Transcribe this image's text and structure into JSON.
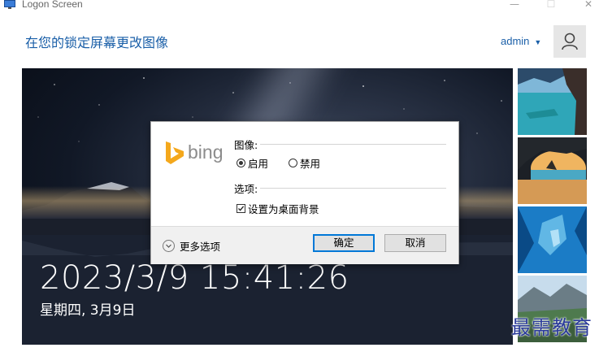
{
  "window": {
    "title": "Logon Screen",
    "min_icon": "minimize-icon",
    "max_icon": "maximize-icon",
    "close_icon": "close-icon"
  },
  "header": {
    "heading": "在您的锁定屏幕更改图像",
    "user_name": "admin",
    "user_caret": "▼"
  },
  "preview": {
    "time": "2023/3/9 15:41:26",
    "date": "星期四, 3月9日"
  },
  "dialog": {
    "logo_text": "bing",
    "image_label": "图像:",
    "enable_label": "启用",
    "enable_selected": true,
    "disable_label": "禁用",
    "options_label": "选项:",
    "set_desktop_label": "设置为桌面背景",
    "set_desktop_checked": true,
    "more_options": "更多选项",
    "ok_label": "确定",
    "cancel_label": "取消"
  },
  "watermark": "最需教育",
  "colors": {
    "accent": "#1a5fa8",
    "bing_orange": "#f4a81c",
    "primary_border": "#0078d7"
  }
}
